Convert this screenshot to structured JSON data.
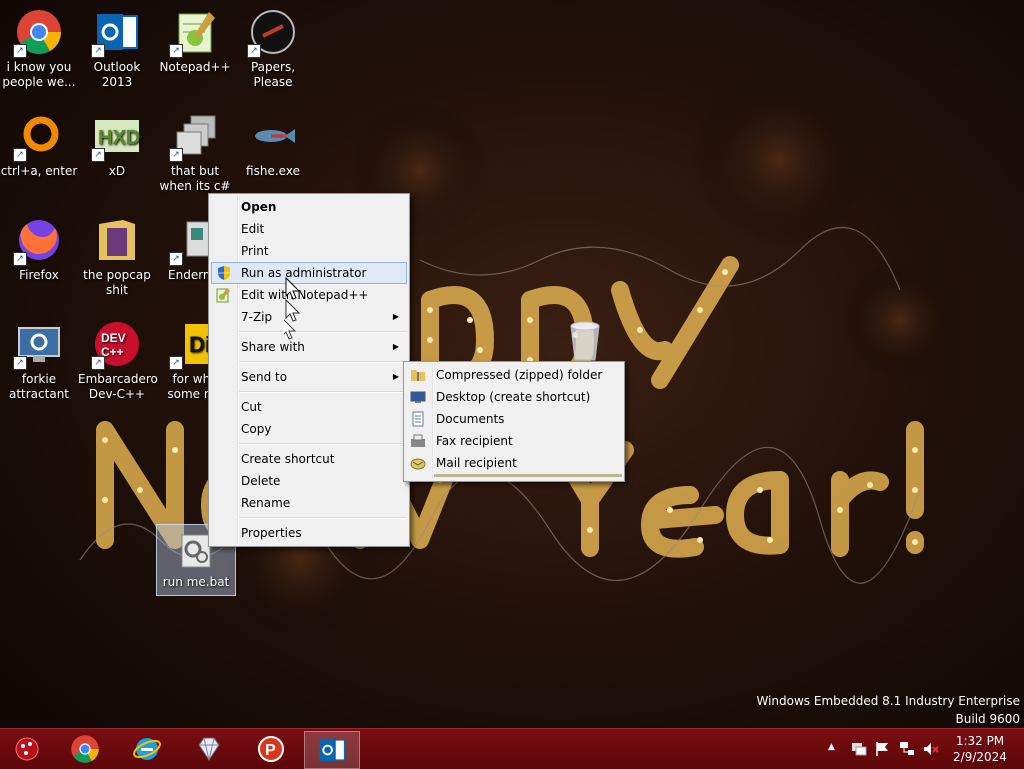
{
  "desktop": {
    "icons": [
      {
        "label": "i know you people we...",
        "icon": "chrome-icon"
      },
      {
        "label": "Outlook 2013",
        "icon": "outlook-icon"
      },
      {
        "label": "Notepad++",
        "icon": "notepadpp-icon"
      },
      {
        "label": "Papers, Please",
        "icon": "papers-please-icon"
      },
      {
        "label": "ctrl+a, enter",
        "icon": "orange-ring-icon"
      },
      {
        "label": "xD",
        "icon": "hxd-icon"
      },
      {
        "label": "that but when its c#",
        "icon": "windows-stack-icon"
      },
      {
        "label": "fishe.exe",
        "icon": "fish-icon"
      },
      {
        "label": "Firefox",
        "icon": "firefox-icon"
      },
      {
        "label": "the popcap shit",
        "icon": "folder-icon"
      },
      {
        "label": "Enderma",
        "icon": "window-icon"
      },
      {
        "label": "forkie attractant",
        "icon": "monitor-gear-icon"
      },
      {
        "label": "Embarcadero Dev-C++",
        "icon": "devcpp-icon"
      },
      {
        "label": "for whe some rus",
        "icon": "di-icon"
      },
      {
        "label": "run me.bat",
        "icon": "batch-file-icon"
      }
    ]
  },
  "wallpaper": {
    "line1": "Happy",
    "line2": "New Year!"
  },
  "context_menu": {
    "items": [
      {
        "label": "Open",
        "bold": true
      },
      {
        "label": "Edit"
      },
      {
        "label": "Print"
      },
      {
        "label": "Run as administrator",
        "icon": "uac-shield-icon",
        "highlighted": true
      },
      {
        "label": "Edit with Notepad++",
        "icon": "notepadpp-icon"
      },
      {
        "label": "7-Zip",
        "submenu": true
      },
      {
        "label": "Share with",
        "submenu": true
      },
      {
        "label": "Send to",
        "submenu": true
      },
      {
        "label": "Cut"
      },
      {
        "label": "Copy"
      },
      {
        "label": "Create shortcut"
      },
      {
        "label": "Delete"
      },
      {
        "label": "Rename"
      },
      {
        "label": "Properties"
      }
    ]
  },
  "sendto_menu": {
    "items": [
      {
        "label": "Compressed (zipped) folder",
        "icon": "zip-folder-icon"
      },
      {
        "label": "Desktop (create shortcut)",
        "icon": "desktop-icon"
      },
      {
        "label": "Documents",
        "icon": "documents-icon"
      },
      {
        "label": "Fax recipient",
        "icon": "fax-icon"
      },
      {
        "label": "Mail recipient",
        "icon": "mail-icon"
      }
    ]
  },
  "watermark": {
    "line1": "Windows Embedded 8.1 Industry Enterprise",
    "line2": "Build 9600"
  },
  "taskbar": {
    "apps": [
      "start-orb-icon",
      "chrome-icon",
      "ie-icon",
      "gem-icon",
      "popcap-icon",
      "outlook-icon"
    ],
    "time": "1:32 PM",
    "date": "2/9/2024",
    "tray_expand": "▲"
  },
  "colors": {
    "menu_bg": "#f0f0f0",
    "menu_highlight": "#dfe9f6",
    "taskbar": "#6a0a0e",
    "bulb": "#ffd77a"
  }
}
